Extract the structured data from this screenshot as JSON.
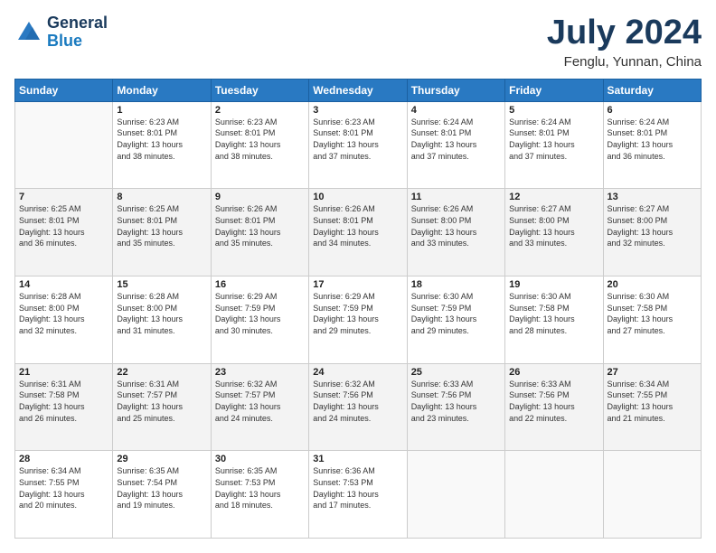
{
  "logo": {
    "general": "General",
    "blue": "Blue"
  },
  "title": "July 2024",
  "subtitle": "Fenglu, Yunnan, China",
  "weekdays": [
    "Sunday",
    "Monday",
    "Tuesday",
    "Wednesday",
    "Thursday",
    "Friday",
    "Saturday"
  ],
  "weeks": [
    [
      {
        "day": "",
        "sunrise": "",
        "sunset": "",
        "daylight": ""
      },
      {
        "day": "1",
        "sunrise": "Sunrise: 6:23 AM",
        "sunset": "Sunset: 8:01 PM",
        "daylight": "Daylight: 13 hours and 38 minutes."
      },
      {
        "day": "2",
        "sunrise": "Sunrise: 6:23 AM",
        "sunset": "Sunset: 8:01 PM",
        "daylight": "Daylight: 13 hours and 38 minutes."
      },
      {
        "day": "3",
        "sunrise": "Sunrise: 6:23 AM",
        "sunset": "Sunset: 8:01 PM",
        "daylight": "Daylight: 13 hours and 37 minutes."
      },
      {
        "day": "4",
        "sunrise": "Sunrise: 6:24 AM",
        "sunset": "Sunset: 8:01 PM",
        "daylight": "Daylight: 13 hours and 37 minutes."
      },
      {
        "day": "5",
        "sunrise": "Sunrise: 6:24 AM",
        "sunset": "Sunset: 8:01 PM",
        "daylight": "Daylight: 13 hours and 37 minutes."
      },
      {
        "day": "6",
        "sunrise": "Sunrise: 6:24 AM",
        "sunset": "Sunset: 8:01 PM",
        "daylight": "Daylight: 13 hours and 36 minutes."
      }
    ],
    [
      {
        "day": "7",
        "sunrise": "Sunrise: 6:25 AM",
        "sunset": "Sunset: 8:01 PM",
        "daylight": "Daylight: 13 hours and 36 minutes."
      },
      {
        "day": "8",
        "sunrise": "Sunrise: 6:25 AM",
        "sunset": "Sunset: 8:01 PM",
        "daylight": "Daylight: 13 hours and 35 minutes."
      },
      {
        "day": "9",
        "sunrise": "Sunrise: 6:26 AM",
        "sunset": "Sunset: 8:01 PM",
        "daylight": "Daylight: 13 hours and 35 minutes."
      },
      {
        "day": "10",
        "sunrise": "Sunrise: 6:26 AM",
        "sunset": "Sunset: 8:01 PM",
        "daylight": "Daylight: 13 hours and 34 minutes."
      },
      {
        "day": "11",
        "sunrise": "Sunrise: 6:26 AM",
        "sunset": "Sunset: 8:00 PM",
        "daylight": "Daylight: 13 hours and 33 minutes."
      },
      {
        "day": "12",
        "sunrise": "Sunrise: 6:27 AM",
        "sunset": "Sunset: 8:00 PM",
        "daylight": "Daylight: 13 hours and 33 minutes."
      },
      {
        "day": "13",
        "sunrise": "Sunrise: 6:27 AM",
        "sunset": "Sunset: 8:00 PM",
        "daylight": "Daylight: 13 hours and 32 minutes."
      }
    ],
    [
      {
        "day": "14",
        "sunrise": "Sunrise: 6:28 AM",
        "sunset": "Sunset: 8:00 PM",
        "daylight": "Daylight: 13 hours and 32 minutes."
      },
      {
        "day": "15",
        "sunrise": "Sunrise: 6:28 AM",
        "sunset": "Sunset: 8:00 PM",
        "daylight": "Daylight: 13 hours and 31 minutes."
      },
      {
        "day": "16",
        "sunrise": "Sunrise: 6:29 AM",
        "sunset": "Sunset: 7:59 PM",
        "daylight": "Daylight: 13 hours and 30 minutes."
      },
      {
        "day": "17",
        "sunrise": "Sunrise: 6:29 AM",
        "sunset": "Sunset: 7:59 PM",
        "daylight": "Daylight: 13 hours and 29 minutes."
      },
      {
        "day": "18",
        "sunrise": "Sunrise: 6:30 AM",
        "sunset": "Sunset: 7:59 PM",
        "daylight": "Daylight: 13 hours and 29 minutes."
      },
      {
        "day": "19",
        "sunrise": "Sunrise: 6:30 AM",
        "sunset": "Sunset: 7:58 PM",
        "daylight": "Daylight: 13 hours and 28 minutes."
      },
      {
        "day": "20",
        "sunrise": "Sunrise: 6:30 AM",
        "sunset": "Sunset: 7:58 PM",
        "daylight": "Daylight: 13 hours and 27 minutes."
      }
    ],
    [
      {
        "day": "21",
        "sunrise": "Sunrise: 6:31 AM",
        "sunset": "Sunset: 7:58 PM",
        "daylight": "Daylight: 13 hours and 26 minutes."
      },
      {
        "day": "22",
        "sunrise": "Sunrise: 6:31 AM",
        "sunset": "Sunset: 7:57 PM",
        "daylight": "Daylight: 13 hours and 25 minutes."
      },
      {
        "day": "23",
        "sunrise": "Sunrise: 6:32 AM",
        "sunset": "Sunset: 7:57 PM",
        "daylight": "Daylight: 13 hours and 24 minutes."
      },
      {
        "day": "24",
        "sunrise": "Sunrise: 6:32 AM",
        "sunset": "Sunset: 7:56 PM",
        "daylight": "Daylight: 13 hours and 24 minutes."
      },
      {
        "day": "25",
        "sunrise": "Sunrise: 6:33 AM",
        "sunset": "Sunset: 7:56 PM",
        "daylight": "Daylight: 13 hours and 23 minutes."
      },
      {
        "day": "26",
        "sunrise": "Sunrise: 6:33 AM",
        "sunset": "Sunset: 7:56 PM",
        "daylight": "Daylight: 13 hours and 22 minutes."
      },
      {
        "day": "27",
        "sunrise": "Sunrise: 6:34 AM",
        "sunset": "Sunset: 7:55 PM",
        "daylight": "Daylight: 13 hours and 21 minutes."
      }
    ],
    [
      {
        "day": "28",
        "sunrise": "Sunrise: 6:34 AM",
        "sunset": "Sunset: 7:55 PM",
        "daylight": "Daylight: 13 hours and 20 minutes."
      },
      {
        "day": "29",
        "sunrise": "Sunrise: 6:35 AM",
        "sunset": "Sunset: 7:54 PM",
        "daylight": "Daylight: 13 hours and 19 minutes."
      },
      {
        "day": "30",
        "sunrise": "Sunrise: 6:35 AM",
        "sunset": "Sunset: 7:53 PM",
        "daylight": "Daylight: 13 hours and 18 minutes."
      },
      {
        "day": "31",
        "sunrise": "Sunrise: 6:36 AM",
        "sunset": "Sunset: 7:53 PM",
        "daylight": "Daylight: 13 hours and 17 minutes."
      },
      {
        "day": "",
        "sunrise": "",
        "sunset": "",
        "daylight": ""
      },
      {
        "day": "",
        "sunrise": "",
        "sunset": "",
        "daylight": ""
      },
      {
        "day": "",
        "sunrise": "",
        "sunset": "",
        "daylight": ""
      }
    ]
  ]
}
